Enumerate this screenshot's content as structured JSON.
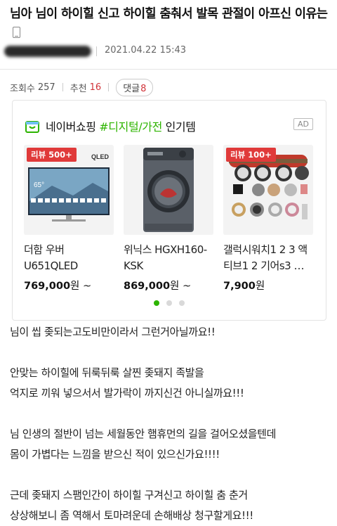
{
  "post": {
    "title": "님아 님이 하이힐 신고 하이힐 춤춰서 발목 관절이 아프신 이유는",
    "date": "2021.04.22 15:43",
    "stats": {
      "views_label": "조회수",
      "views": "257",
      "likes_label": "추천",
      "likes": "16",
      "comments_label": "댓글",
      "comments": "8"
    }
  },
  "ad": {
    "brand": "네이버쇼핑",
    "category": "#디지털/가전",
    "suffix": "인기템",
    "badge": "AD",
    "products": [
      {
        "badge": "리뷰 500+",
        "name": "더함 우버 U651QLED",
        "price": "769,000",
        "unit": "원 ~"
      },
      {
        "badge": "",
        "name": "위닉스 HGXH160-KSK",
        "price": "869,000",
        "unit": "원 ~"
      },
      {
        "badge": "리뷰 100+",
        "name": "갤럭시워치1 2 3 액티브1 2 기어s3 …",
        "price": "7,900",
        "unit": "원"
      }
    ],
    "tv_brand": "QLED",
    "tv_temp": "65°"
  },
  "body": {
    "lines": [
      "님이 씹 좆되는고도비만이라서 그런거아닐까요!!",
      "",
      "안맞는 하이힐에 뒤룩뒤룩 살찐 좆돼지 족발을",
      "억지로 끼워 넣으서서 발가락이 까지신건 아니실까요!!!",
      "",
      "님 인생의 절반이 넘는 세월동안 햄휴먼의 길을 걸어오셨을텐데",
      "몸이 가볍다는 느낌을 받으신 적이 있으신가요!!!!",
      "",
      "근데 좆돼지 스팸인간이 하이힐 구겨신고 하이힐 춤 춘거",
      "상상해보니 좀 역해서 토마려운데 손해배상 청구할게요!!!"
    ]
  }
}
